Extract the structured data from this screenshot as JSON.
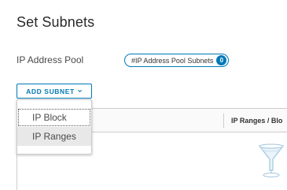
{
  "page": {
    "title": "Set Subnets"
  },
  "ip_pool": {
    "label": "IP Address Pool",
    "chip_label": "#IP Address Pool Subnets",
    "chip_count": "0"
  },
  "add_subnet": {
    "label": "ADD SUBNET",
    "menu_items": [
      {
        "label": "IP Block"
      },
      {
        "label": "IP Ranges"
      }
    ]
  },
  "grid": {
    "columns": [
      {
        "label": "IP Ranges / Blo"
      }
    ]
  },
  "colors": {
    "accent": "#0079b8",
    "border": "#cccccc",
    "hover": "#e8e8e8"
  },
  "icons": {
    "empty_state": "empty-funnel-icon",
    "dropdown": "chevron-down-icon"
  }
}
